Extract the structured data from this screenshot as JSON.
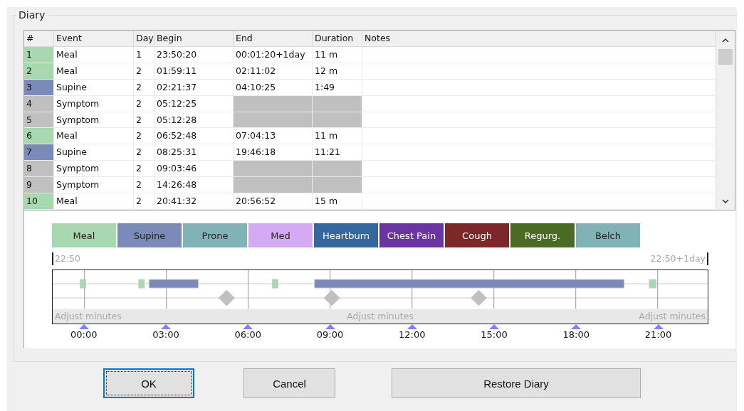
{
  "group_title": "Diary",
  "table": {
    "columns": [
      "#",
      "Event",
      "Day",
      "Begin",
      "End",
      "Duration",
      "Notes"
    ],
    "rows": [
      {
        "number": "1",
        "event": "Meal",
        "day": "1",
        "begin": "23:50:20",
        "end": "00:01:20+1day",
        "duration": "11 m",
        "kind": "span",
        "color": "#a8d8b0"
      },
      {
        "number": "2",
        "event": "Meal",
        "day": "2",
        "begin": "01:59:11",
        "end": "02:11:02",
        "duration": "12 m",
        "kind": "span",
        "color": "#a8d8b0"
      },
      {
        "number": "3",
        "event": "Supine",
        "day": "2",
        "begin": "02:21:37",
        "end": "04:10:25",
        "duration": "1:49",
        "kind": "span",
        "color": "#7b8ab8"
      },
      {
        "number": "4",
        "event": "Symptom",
        "day": "2",
        "begin": "05:12:25",
        "kind": "point",
        "color": "#c0c0c0"
      },
      {
        "number": "5",
        "event": "Symptom",
        "day": "2",
        "begin": "05:12:28",
        "kind": "point",
        "color": "#c0c0c0"
      },
      {
        "number": "6",
        "event": "Meal",
        "day": "2",
        "begin": "06:52:48",
        "end": "07:04:13",
        "duration": "11 m",
        "kind": "span",
        "color": "#a8d8b0"
      },
      {
        "number": "7",
        "event": "Supine",
        "day": "2",
        "begin": "08:25:31",
        "end": "19:46:18",
        "duration": "11:21",
        "kind": "span",
        "color": "#7b8ab8"
      },
      {
        "number": "8",
        "event": "Symptom",
        "day": "2",
        "begin": "09:03:46",
        "kind": "point",
        "color": "#c0c0c0"
      },
      {
        "number": "9",
        "event": "Symptom",
        "day": "2",
        "begin": "14:26:48",
        "kind": "point",
        "color": "#c0c0c0"
      },
      {
        "number": "10",
        "event": "Meal",
        "day": "2",
        "begin": "20:41:32",
        "end": "20:56:52",
        "duration": "15 m",
        "kind": "span",
        "color": "#a8d8b0"
      }
    ]
  },
  "legend": [
    {
      "label": "Meal",
      "color": "#a8d8b0"
    },
    {
      "label": "Supine",
      "color": "#7b8ab8"
    },
    {
      "label": "Prone",
      "color": "#7fb3b5"
    },
    {
      "label": "Med",
      "color": "#d5aaf5"
    },
    {
      "label": "Heartburn",
      "color": "#35679f"
    },
    {
      "label": "Chest Pain",
      "color": "#6a35a0"
    },
    {
      "label": "Cough",
      "color": "#7d2828"
    },
    {
      "label": "Regurg.",
      "color": "#4a6b25"
    },
    {
      "label": "Belch",
      "color": "#7fb3b5"
    }
  ],
  "timeline": {
    "start_label": "22:50",
    "end_label": "22:50+1day",
    "adjust_labels": [
      "Adjust minutes",
      "Adjust minutes",
      "Adjust minutes"
    ],
    "ticks": [
      "00:00",
      "03:00",
      "06:00",
      "09:00",
      "12:00",
      "15:00",
      "18:00",
      "21:00"
    ]
  },
  "buttons": [
    {
      "label": "OK",
      "focused": true
    },
    {
      "label": "Cancel",
      "focused": false
    },
    {
      "label": "Restore Diary",
      "focused": false
    }
  ]
}
